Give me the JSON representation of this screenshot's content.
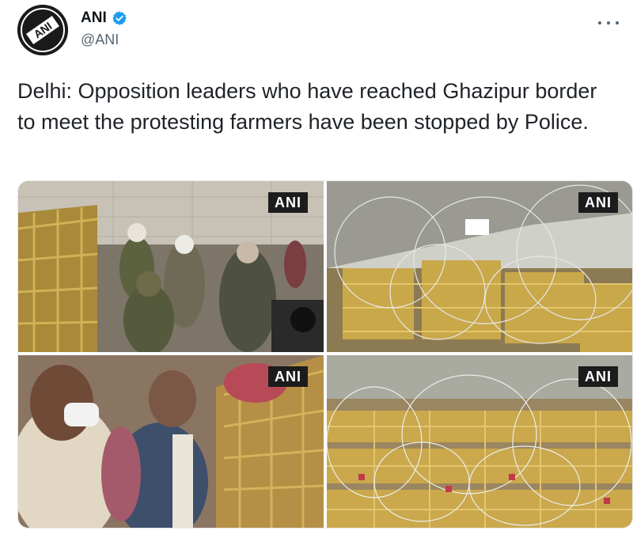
{
  "author": {
    "display_name": "ANI",
    "handle": "@ANI",
    "avatar_text": "ANI",
    "verified": true
  },
  "tweet": {
    "text": "Delhi: Opposition leaders who have reached Ghazipur border to meet the protesting farmers have been stopped by Police."
  },
  "media": {
    "photos": [
      {
        "watermark": "ANI"
      },
      {
        "watermark": "ANI"
      },
      {
        "watermark": "ANI"
      },
      {
        "watermark": "ANI"
      }
    ]
  },
  "colors": {
    "verified_badge": "#1d9bf0",
    "text_primary": "#0f1419",
    "text_secondary": "#536471",
    "barricade_yellow": "#c9a84a",
    "wire_grey": "#cfd3d6"
  },
  "icons": {
    "verified": "verified-badge-icon",
    "more": "more-options-icon"
  }
}
